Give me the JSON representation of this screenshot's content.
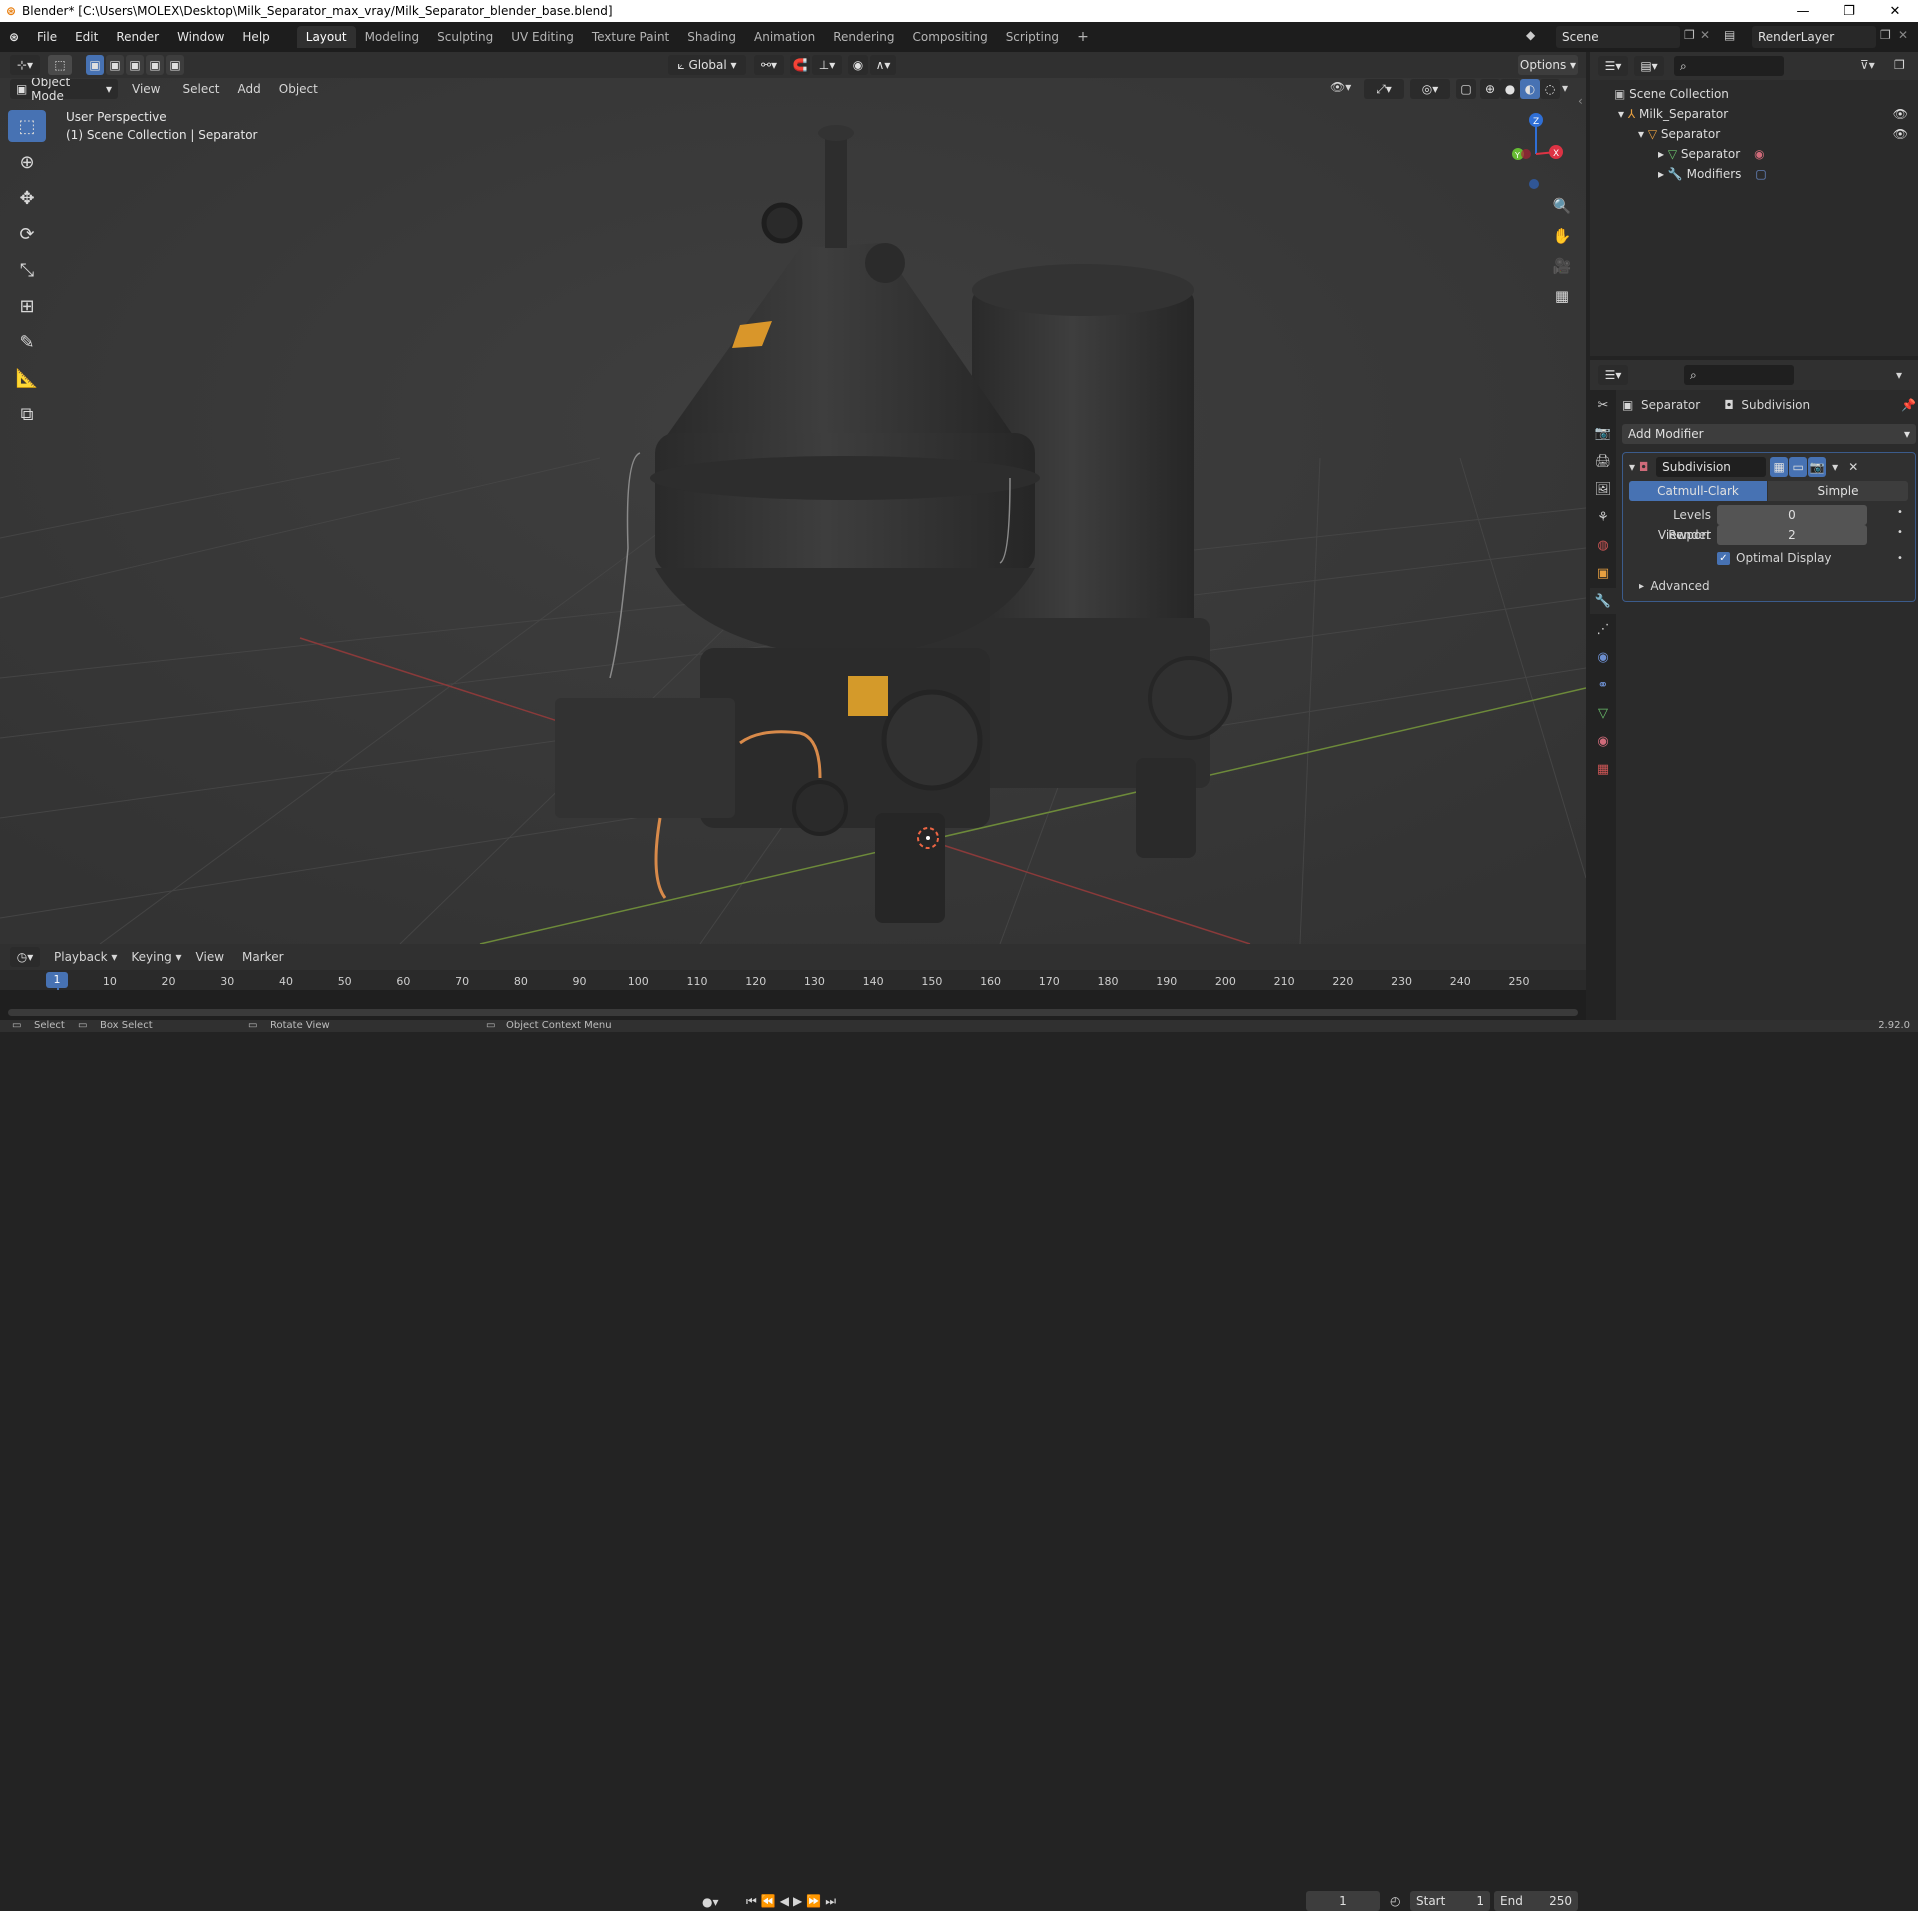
{
  "window": {
    "title": "Blender* [C:\\Users\\MOLEX\\Desktop\\Milk_Separator_max_vray/Milk_Separator_blender_base.blend]",
    "min": "—",
    "max": "❐",
    "close": "✕"
  },
  "menus": [
    "File",
    "Edit",
    "Render",
    "Window",
    "Help"
  ],
  "workspaces": [
    "Layout",
    "Modeling",
    "Sculpting",
    "UV Editing",
    "Texture Paint",
    "Shading",
    "Animation",
    "Rendering",
    "Compositing",
    "Scripting"
  ],
  "workspace_add": "+",
  "scene": {
    "name": "Scene",
    "view_layer": "RenderLayer"
  },
  "viewport_header": {
    "mode": "Object Mode",
    "menu": [
      "View",
      "Select",
      "Add",
      "Object"
    ],
    "orientation": "Global",
    "options": "Options"
  },
  "viewport": {
    "perspective": "User Perspective",
    "collection": "(1) Scene Collection | Separator",
    "gizmo": {
      "z": "Z",
      "x": "X",
      "y": "Y"
    }
  },
  "outliner": {
    "root": "Scene Collection",
    "items": [
      {
        "label": "Milk_Separator"
      },
      {
        "label": "Separator"
      },
      {
        "label": "Separator"
      },
      {
        "label": "Modifiers"
      }
    ]
  },
  "properties": {
    "breadcrumb_object": "Separator",
    "breadcrumb_modifier": "Subdivision",
    "add_modifier": "Add Modifier",
    "modifier_name": "Subdivision",
    "algo_catmull": "Catmull-Clark",
    "algo_simple": "Simple",
    "levels_viewport_label": "Levels Viewport",
    "levels_viewport_value": "0",
    "render_label": "Render",
    "render_value": "2",
    "optimal_display": "Optimal Display",
    "advanced": "Advanced"
  },
  "timeline": {
    "menu": [
      "Playback",
      "Keying",
      "View",
      "Marker"
    ],
    "current_frame": "1",
    "start_label": "Start",
    "start": "1",
    "end_label": "End",
    "end": "250",
    "ruler": [
      "1",
      "10",
      "20",
      "30",
      "40",
      "50",
      "60",
      "70",
      "80",
      "90",
      "100",
      "110",
      "120",
      "130",
      "140",
      "150",
      "160",
      "170",
      "180",
      "190",
      "200",
      "210",
      "220",
      "230",
      "240",
      "250"
    ],
    "ruler_current": "1"
  },
  "status": {
    "select": "Select",
    "box_select": "Box Select",
    "rotate_view": "Rotate View",
    "context_menu": "Object Context Menu",
    "version": "2.92.0"
  },
  "colors": {
    "accent": "#4772b3",
    "orange": "#e87d0d"
  }
}
